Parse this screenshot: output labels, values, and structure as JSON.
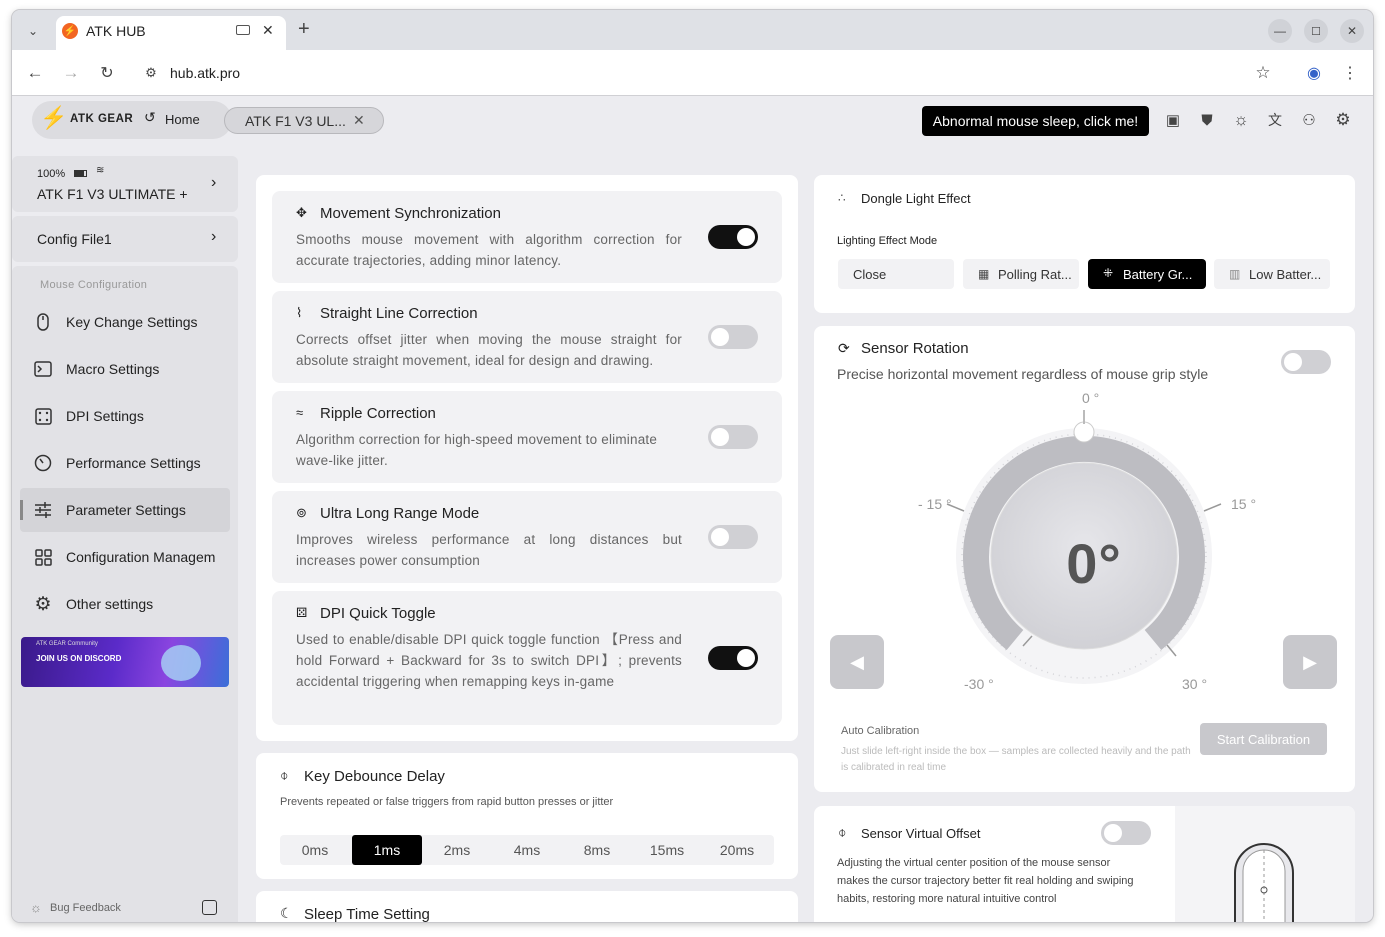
{
  "browser": {
    "tab_title": "ATK HUB",
    "url": "hub.atk.pro",
    "new_tab": "+"
  },
  "header": {
    "logo_text": "ATK GEAR",
    "home_label": "Home",
    "device_tab": "ATK F1 V3 UL...",
    "alert_button": "Abnormal mouse sleep, click me!"
  },
  "sidebar": {
    "battery": "100%",
    "device_name": "ATK F1 V3 ULTIMATE +",
    "config_file": "Config File1",
    "section_title": "Mouse Configuration",
    "items": [
      {
        "label": "Key Change Settings",
        "icon": "mouse-icon"
      },
      {
        "label": "Macro Settings",
        "icon": "terminal-icon"
      },
      {
        "label": "DPI Settings",
        "icon": "dice-icon"
      },
      {
        "label": "Performance Settings",
        "icon": "gauge-icon"
      },
      {
        "label": "Parameter Settings",
        "icon": "sliders-icon",
        "active": true
      },
      {
        "label": "Configuration Managem",
        "icon": "grid-icon"
      },
      {
        "label": "Other settings",
        "icon": "gear-icon"
      }
    ],
    "banner_title": "JOIN US ON DISCORD",
    "banner_small": "ATK GEAR Community",
    "bug_feedback": "Bug Feedback"
  },
  "settings": [
    {
      "title": "Movement Synchronization",
      "desc": "Smooths mouse movement with algorithm correction for accurate trajectories, adding minor latency.",
      "on": true
    },
    {
      "title": "Straight Line Correction",
      "desc": "Corrects offset jitter when moving the mouse straight for absolute straight movement, ideal for design and drawing.",
      "on": false
    },
    {
      "title": "Ripple Correction",
      "desc": "Algorithm correction for high-speed movement to eliminate wave-like jitter.",
      "on": false
    },
    {
      "title": "Ultra Long Range Mode",
      "desc": "Improves wireless performance at long distances but increases power consumption",
      "on": false
    },
    {
      "title": "DPI Quick Toggle",
      "desc": "Used to enable/disable DPI quick toggle function 【Press and hold Forward + Backward for 3s to switch DPI】; prevents accidental triggering when remapping keys in-game",
      "on": true
    }
  ],
  "debounce": {
    "title": "Key Debounce Delay",
    "desc": "Prevents repeated or false triggers from rapid button presses or jitter",
    "options": [
      "0ms",
      "1ms",
      "2ms",
      "4ms",
      "8ms",
      "15ms",
      "20ms"
    ],
    "selected": "1ms"
  },
  "sleep": {
    "title": "Sleep Time Setting"
  },
  "dongle": {
    "title": "Dongle Light Effect",
    "mode_label": "Lighting Effect Mode",
    "options": [
      "Close",
      "Polling Rat...",
      "Battery Gr...",
      "Low Batter..."
    ],
    "selected": "Battery Gr..."
  },
  "rotation": {
    "title": "Sensor Rotation",
    "desc": "Precise horizontal movement regardless of mouse grip style",
    "on": false,
    "value": "0°",
    "ticks": {
      "top": "0 °",
      "left15": "- 15 °",
      "right15": "15 °",
      "left30": "-30 °",
      "right30": "30 °"
    },
    "auto_title": "Auto Calibration",
    "auto_desc": "Just slide left-right inside the box — samples are collected heavily and the path is calibrated in real time",
    "calibrate_button": "Start Calibration"
  },
  "offset": {
    "title": "Sensor Virtual Offset",
    "desc": "Adjusting the virtual center position of the mouse sensor makes the cursor trajectory better fit real holding and swiping habits, restoring more natural intuitive control",
    "on": false
  }
}
